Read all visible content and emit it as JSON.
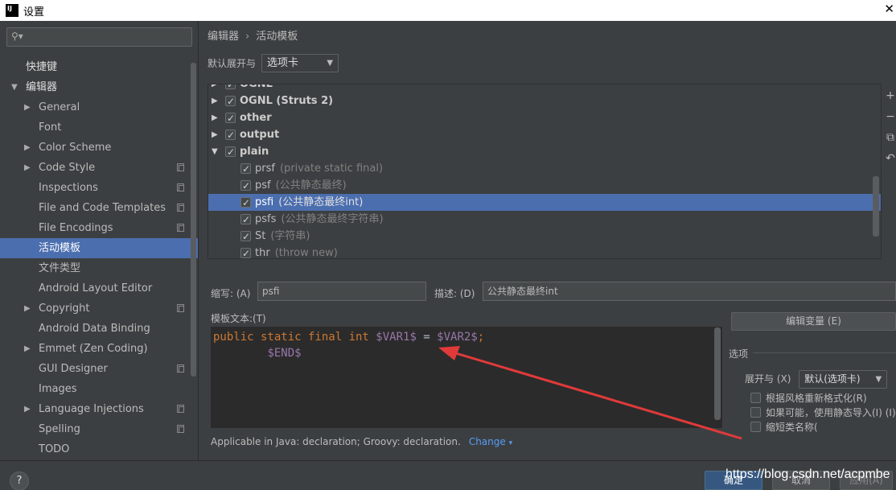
{
  "window": {
    "title": "设置"
  },
  "sidebar": {
    "items": [
      {
        "label": "快捷键",
        "indent": 32,
        "arrow": ""
      },
      {
        "label": "编辑器",
        "indent": 32,
        "arrow": "down"
      },
      {
        "label": "General",
        "indent": 48,
        "arrow": "right"
      },
      {
        "label": "Font",
        "indent": 48,
        "arrow": ""
      },
      {
        "label": "Color Scheme",
        "indent": 48,
        "arrow": "right"
      },
      {
        "label": "Code Style",
        "indent": 48,
        "arrow": "right",
        "copy": true
      },
      {
        "label": "Inspections",
        "indent": 48,
        "arrow": "",
        "copy": true
      },
      {
        "label": "File and Code Templates",
        "indent": 48,
        "arrow": "",
        "copy": true
      },
      {
        "label": "File Encodings",
        "indent": 48,
        "arrow": "",
        "copy": true
      },
      {
        "label": "活动模板",
        "indent": 48,
        "arrow": "",
        "selected": true
      },
      {
        "label": "文件类型",
        "indent": 48,
        "arrow": ""
      },
      {
        "label": "Android Layout Editor",
        "indent": 48,
        "arrow": ""
      },
      {
        "label": "Copyright",
        "indent": 48,
        "arrow": "right",
        "copy": true
      },
      {
        "label": "Android Data Binding",
        "indent": 48,
        "arrow": ""
      },
      {
        "label": "Emmet (Zen Coding)",
        "indent": 48,
        "arrow": "right"
      },
      {
        "label": "GUI Designer",
        "indent": 48,
        "arrow": "",
        "copy": true
      },
      {
        "label": "Images",
        "indent": 48,
        "arrow": ""
      },
      {
        "label": "Language Injections",
        "indent": 48,
        "arrow": "right",
        "copy": true
      },
      {
        "label": "Spelling",
        "indent": 48,
        "arrow": "",
        "copy": true
      },
      {
        "label": "TODO",
        "indent": 48,
        "arrow": ""
      }
    ]
  },
  "breadcrumb": {
    "part1": "编辑器",
    "separator": "›",
    "part2": "活动模板"
  },
  "expand": {
    "label": "默认展开与",
    "value": "选项卡"
  },
  "templates": {
    "rows": [
      {
        "type": "group",
        "name": "OGNL",
        "expanded": false,
        "partial": true
      },
      {
        "type": "group",
        "name": "OGNL (Struts 2)",
        "expanded": false
      },
      {
        "type": "group",
        "name": "other",
        "expanded": false
      },
      {
        "type": "group",
        "name": "output",
        "expanded": false
      },
      {
        "type": "group",
        "name": "plain",
        "expanded": true
      },
      {
        "type": "item",
        "abbr": "prsf",
        "desc": "(private static final)"
      },
      {
        "type": "item",
        "abbr": "psf",
        "desc": "(公共静态最终)"
      },
      {
        "type": "item",
        "abbr": "psfi",
        "desc": "(公共静态最终int)",
        "selected": true
      },
      {
        "type": "item",
        "abbr": "psfs",
        "desc": "(公共静态最终字符串)"
      },
      {
        "type": "item",
        "abbr": "St",
        "desc": "(字符串)"
      },
      {
        "type": "item",
        "abbr": "thr",
        "desc": "(throw new)"
      }
    ]
  },
  "toolbar": {
    "add": "+",
    "remove": "−",
    "copy": "⧉",
    "revert": "↶"
  },
  "fields": {
    "abbr_label": "缩写: (A)",
    "abbr_value": "psfi",
    "desc_label": "描述: (D)",
    "desc_value": "公共静态最终int",
    "template_text_label": "模板文本:(T)"
  },
  "editor": {
    "line1": {
      "kw": "public static final int ",
      "var1": "$VAR1$",
      "eq": " = ",
      "var2": "$VAR2$",
      "semi": ";"
    },
    "line2": {
      "indent": "        ",
      "end": "$END$"
    }
  },
  "edit_vars_button": "编辑变量 (E)",
  "options": {
    "title": "选项",
    "expand_label": "展开与 (X)",
    "expand_value": "默认(选项卡)",
    "reformat": "根据风格重新格式化(R)",
    "static_import": "如果可能，使用静态导入(I) (I)",
    "shorten": "缩短类名称("
  },
  "applicable": {
    "text": "Applicable in Java: declaration; Groovy: declaration.",
    "change": "Change"
  },
  "footer": {
    "help": "?",
    "ok": "确定",
    "cancel": "取消",
    "apply": "应用(A)",
    "watermark": "https://blog.csdn.net/acpmbe"
  },
  "colors": {
    "selection": "#4b6eaf",
    "keyword": "#cc7832",
    "variable": "#9876aa",
    "arrow": "#e03a3a",
    "link": "#589df6"
  },
  "icons": [
    "search-icon",
    "checkbox-icon",
    "expand-arrow-icon",
    "add-icon",
    "remove-icon",
    "copy-icon",
    "revert-icon",
    "help-icon"
  ]
}
